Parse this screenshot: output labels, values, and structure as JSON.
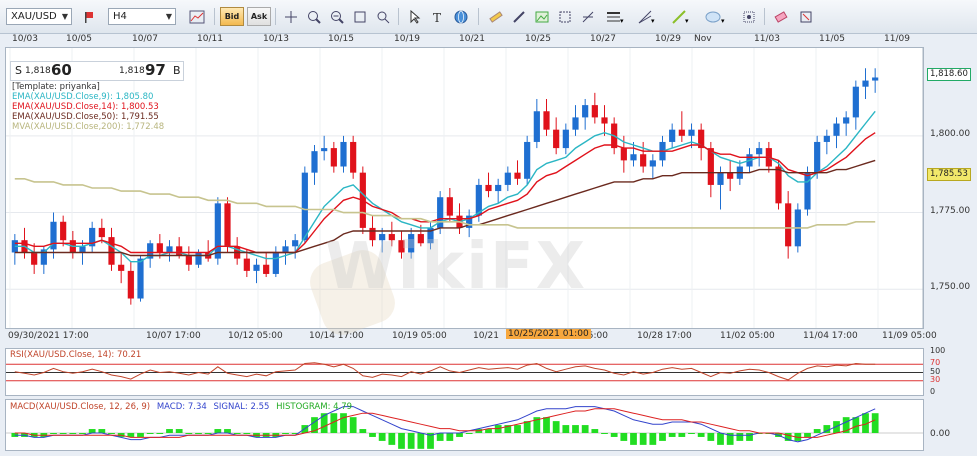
{
  "toolbar": {
    "symbol": "XAU/USD",
    "timeframe": "H4",
    "bid_label": "Bid",
    "ask_label": "Ask",
    "icons": [
      "flag-icon",
      "chart-icon",
      "bid-icon",
      "ask-icon",
      "crosshair-icon",
      "zoom-in-icon",
      "zoom-out-icon",
      "zoom-fit-icon",
      "cursor-icon",
      "text-icon",
      "shapes-icon",
      "globe-icon",
      "ruler-icon",
      "pen-icon",
      "picture-icon",
      "resize-icon",
      "fork-icon",
      "line-icon",
      "fan-icon",
      "trend-line-icon",
      "ellipse-icon",
      "settings-icon",
      "eraser-icon",
      "delete-icon"
    ]
  },
  "quote": {
    "sell_prefix": "S",
    "sell_small": "1,818",
    "sell_big": "60",
    "buy_small": "1,818",
    "buy_big": "97",
    "buy_prefix": "B"
  },
  "legend": {
    "template": "[Template: priyanka]",
    "ema9": "EMA(XAU/USD.Close,9): 1,805.80",
    "ema14": "EMA(XAU/USD.Close,14): 1,800.53",
    "ema50": "EMA(XAU/USD.Close,50): 1,791.55",
    "mva200": "MVA(XAU/USD.Close,200): 1,772.48"
  },
  "colors": {
    "ema9": "#2bb6c4",
    "ema14": "#e0121b",
    "ema50": "#6b2a1f",
    "mva200": "#c7c48f",
    "bull": "#1f6fd1",
    "bear": "#e0121b",
    "rsi": "#c0442a",
    "macd": "#3344cc",
    "signal": "#dd2222",
    "histogram": "#22dd22",
    "highlight": "#f7a73d"
  },
  "top_dates": [
    "10/03",
    "10/05",
    "10/07",
    "10/11",
    "10/13",
    "10/15",
    "10/19",
    "10/21",
    "10/25",
    "10/27",
    "10/29",
    "Nov",
    "11/03",
    "11/05",
    "11/09"
  ],
  "bottom_dates": [
    "09/30/2021 17:00",
    "10/07 17:00",
    "10/12 05:00",
    "10/14 17:00",
    "10/19 05:00",
    "10/21",
    "05:00",
    "10/28 17:00",
    "11/02 05:00",
    "11/04 17:00",
    "11/09 05:00"
  ],
  "crosshair_date": "10/25/2021 01:00",
  "price_ticks": [
    "1,800.00",
    "1,775.00",
    "1,750.00"
  ],
  "last_price": "1,818.60",
  "ema_tag": "1,785.53",
  "rsi": {
    "label": "RSI(XAU/USD.Close, 14): 70.21",
    "ticks": [
      "100",
      "70",
      "50",
      "30",
      "0"
    ]
  },
  "macd": {
    "label_main": "MACD(XAU/USD.Close, 12, 26, 9)",
    "label_macd": "MACD: 7.34",
    "label_signal": "SIGNAL: 2.55",
    "label_hist": "HISTOGRAM: 4.79",
    "tick": "0.00"
  },
  "watermark": "WikiFX",
  "chart_data": {
    "type": "candlestick",
    "ylim": [
      1740,
      1826
    ],
    "candles": [
      [
        1762,
        1768,
        1758,
        1766
      ],
      [
        1766,
        1770,
        1760,
        1762
      ],
      [
        1762,
        1765,
        1755,
        1758
      ],
      [
        1758,
        1764,
        1755,
        1763
      ],
      [
        1763,
        1775,
        1760,
        1772
      ],
      [
        1772,
        1774,
        1764,
        1766
      ],
      [
        1766,
        1769,
        1760,
        1762
      ],
      [
        1762,
        1766,
        1758,
        1764
      ],
      [
        1764,
        1772,
        1762,
        1770
      ],
      [
        1770,
        1773,
        1765,
        1767
      ],
      [
        1767,
        1770,
        1756,
        1758
      ],
      [
        1758,
        1762,
        1752,
        1756
      ],
      [
        1756,
        1759,
        1745,
        1747
      ],
      [
        1747,
        1761,
        1746,
        1760
      ],
      [
        1760,
        1766,
        1757,
        1765
      ],
      [
        1765,
        1768,
        1760,
        1762
      ],
      [
        1762,
        1766,
        1759,
        1764
      ],
      [
        1764,
        1767,
        1760,
        1761
      ],
      [
        1761,
        1764,
        1756,
        1758
      ],
      [
        1758,
        1763,
        1757,
        1762
      ],
      [
        1762,
        1766,
        1759,
        1760
      ],
      [
        1760,
        1780,
        1758,
        1778
      ],
      [
        1778,
        1780,
        1762,
        1764
      ],
      [
        1764,
        1767,
        1758,
        1760
      ],
      [
        1760,
        1763,
        1754,
        1756
      ],
      [
        1756,
        1760,
        1752,
        1758
      ],
      [
        1758,
        1762,
        1754,
        1755
      ],
      [
        1755,
        1764,
        1754,
        1762
      ],
      [
        1762,
        1766,
        1758,
        1764
      ],
      [
        1764,
        1768,
        1760,
        1766
      ],
      [
        1766,
        1790,
        1765,
        1788
      ],
      [
        1788,
        1797,
        1784,
        1795
      ],
      [
        1795,
        1800,
        1792,
        1796
      ],
      [
        1796,
        1798,
        1788,
        1790
      ],
      [
        1790,
        1800,
        1788,
        1798
      ],
      [
        1798,
        1800,
        1786,
        1788
      ],
      [
        1788,
        1790,
        1768,
        1770
      ],
      [
        1770,
        1774,
        1764,
        1766
      ],
      [
        1766,
        1770,
        1762,
        1768
      ],
      [
        1768,
        1772,
        1764,
        1766
      ],
      [
        1766,
        1769,
        1760,
        1762
      ],
      [
        1762,
        1770,
        1760,
        1768
      ],
      [
        1768,
        1771,
        1764,
        1765
      ],
      [
        1765,
        1772,
        1763,
        1770
      ],
      [
        1770,
        1782,
        1768,
        1780
      ],
      [
        1780,
        1783,
        1772,
        1774
      ],
      [
        1774,
        1778,
        1768,
        1770
      ],
      [
        1770,
        1776,
        1767,
        1774
      ],
      [
        1774,
        1786,
        1772,
        1784
      ],
      [
        1784,
        1788,
        1780,
        1782
      ],
      [
        1782,
        1786,
        1778,
        1784
      ],
      [
        1784,
        1790,
        1782,
        1788
      ],
      [
        1788,
        1792,
        1784,
        1786
      ],
      [
        1786,
        1800,
        1784,
        1798
      ],
      [
        1798,
        1812,
        1796,
        1808
      ],
      [
        1808,
        1812,
        1800,
        1802
      ],
      [
        1802,
        1806,
        1794,
        1796
      ],
      [
        1796,
        1804,
        1794,
        1802
      ],
      [
        1802,
        1810,
        1800,
        1806
      ],
      [
        1806,
        1812,
        1802,
        1810
      ],
      [
        1810,
        1814,
        1804,
        1806
      ],
      [
        1806,
        1810,
        1800,
        1804
      ],
      [
        1804,
        1806,
        1794,
        1796
      ],
      [
        1796,
        1800,
        1788,
        1792
      ],
      [
        1792,
        1798,
        1790,
        1794
      ],
      [
        1794,
        1798,
        1788,
        1790
      ],
      [
        1790,
        1794,
        1786,
        1792
      ],
      [
        1792,
        1800,
        1790,
        1798
      ],
      [
        1798,
        1804,
        1796,
        1802
      ],
      [
        1802,
        1808,
        1798,
        1800
      ],
      [
        1800,
        1804,
        1796,
        1802
      ],
      [
        1802,
        1804,
        1792,
        1796
      ],
      [
        1796,
        1798,
        1780,
        1784
      ],
      [
        1784,
        1790,
        1776,
        1788
      ],
      [
        1788,
        1792,
        1782,
        1786
      ],
      [
        1786,
        1792,
        1784,
        1790
      ],
      [
        1790,
        1796,
        1788,
        1794
      ],
      [
        1794,
        1798,
        1790,
        1796
      ],
      [
        1796,
        1798,
        1788,
        1790
      ],
      [
        1790,
        1792,
        1776,
        1778
      ],
      [
        1778,
        1782,
        1760,
        1764
      ],
      [
        1764,
        1778,
        1762,
        1776
      ],
      [
        1776,
        1790,
        1774,
        1788
      ],
      [
        1788,
        1800,
        1786,
        1798
      ],
      [
        1798,
        1802,
        1794,
        1800
      ],
      [
        1800,
        1806,
        1796,
        1804
      ],
      [
        1804,
        1808,
        1800,
        1806
      ],
      [
        1806,
        1818,
        1802,
        1816
      ],
      [
        1816,
        1822,
        1812,
        1818
      ],
      [
        1818,
        1822,
        1814,
        1819
      ]
    ],
    "series": [
      {
        "name": "EMA(XAU/USD.Close,9)",
        "values": [
          1764,
          1764,
          1762,
          1762,
          1765,
          1765,
          1764,
          1764,
          1765,
          1766,
          1764,
          1762,
          1759,
          1759,
          1761,
          1761,
          1762,
          1762,
          1761,
          1761,
          1761,
          1764,
          1764,
          1763,
          1762,
          1761,
          1760,
          1760,
          1761,
          1762,
          1767,
          1772,
          1777,
          1780,
          1783,
          1784,
          1781,
          1778,
          1776,
          1774,
          1772,
          1771,
          1770,
          1770,
          1772,
          1773,
          1772,
          1773,
          1775,
          1777,
          1778,
          1780,
          1781,
          1784,
          1789,
          1791,
          1792,
          1793,
          1796,
          1798,
          1800,
          1801,
          1800,
          1798,
          1797,
          1796,
          1795,
          1795,
          1796,
          1797,
          1798,
          1797,
          1795,
          1793,
          1792,
          1791,
          1792,
          1793,
          1793,
          1791,
          1787,
          1785,
          1785,
          1788,
          1790,
          1793,
          1796,
          1800,
          1804,
          1808
        ]
      },
      {
        "name": "EMA(XAU/USD.Close,14)",
        "values": [
          1765,
          1765,
          1764,
          1764,
          1765,
          1765,
          1765,
          1765,
          1765,
          1766,
          1765,
          1764,
          1762,
          1762,
          1762,
          1762,
          1762,
          1762,
          1762,
          1762,
          1762,
          1764,
          1764,
          1764,
          1763,
          1762,
          1762,
          1762,
          1762,
          1762,
          1765,
          1769,
          1773,
          1776,
          1779,
          1780,
          1779,
          1777,
          1776,
          1775,
          1773,
          1773,
          1772,
          1772,
          1773,
          1773,
          1773,
          1773,
          1774,
          1776,
          1777,
          1778,
          1779,
          1781,
          1785,
          1787,
          1788,
          1790,
          1792,
          1794,
          1796,
          1797,
          1797,
          1796,
          1796,
          1795,
          1795,
          1795,
          1795,
          1796,
          1797,
          1797,
          1795,
          1794,
          1794,
          1793,
          1793,
          1793,
          1793,
          1792,
          1789,
          1788,
          1787,
          1788,
          1789,
          1791,
          1793,
          1796,
          1799,
          1801
        ]
      },
      {
        "name": "EMA(XAU/USD.Close,50)",
        "values": [
          1762,
          1762,
          1762,
          1762,
          1762,
          1762,
          1762,
          1762,
          1762,
          1762,
          1762,
          1762,
          1761,
          1761,
          1761,
          1761,
          1761,
          1761,
          1761,
          1761,
          1761,
          1762,
          1762,
          1762,
          1762,
          1762,
          1762,
          1762,
          1762,
          1762,
          1763,
          1764,
          1765,
          1766,
          1768,
          1769,
          1769,
          1769,
          1769,
          1769,
          1769,
          1769,
          1769,
          1769,
          1770,
          1770,
          1770,
          1771,
          1771,
          1772,
          1773,
          1774,
          1775,
          1776,
          1777,
          1778,
          1779,
          1780,
          1781,
          1782,
          1783,
          1784,
          1785,
          1785,
          1785,
          1786,
          1786,
          1787,
          1787,
          1788,
          1788,
          1788,
          1788,
          1788,
          1788,
          1788,
          1788,
          1789,
          1789,
          1789,
          1788,
          1788,
          1788,
          1788,
          1788,
          1789,
          1789,
          1790,
          1791,
          1792
        ]
      },
      {
        "name": "MVA(XAU/USD.Close,200)",
        "values": [
          1786,
          1786,
          1785,
          1785,
          1785,
          1784,
          1784,
          1784,
          1783,
          1783,
          1783,
          1782,
          1782,
          1782,
          1781,
          1781,
          1781,
          1780,
          1780,
          1780,
          1779,
          1779,
          1779,
          1778,
          1778,
          1778,
          1777,
          1777,
          1777,
          1777,
          1776,
          1776,
          1776,
          1776,
          1775,
          1775,
          1775,
          1774,
          1774,
          1774,
          1773,
          1773,
          1773,
          1772,
          1772,
          1772,
          1772,
          1771,
          1771,
          1771,
          1771,
          1771,
          1770,
          1770,
          1770,
          1770,
          1770,
          1770,
          1770,
          1770,
          1770,
          1770,
          1770,
          1770,
          1770,
          1770,
          1770,
          1770,
          1770,
          1770,
          1770,
          1770,
          1770,
          1770,
          1770,
          1770,
          1770,
          1770,
          1770,
          1770,
          1770,
          1770,
          1770,
          1771,
          1771,
          1771,
          1771,
          1772,
          1772,
          1772
        ]
      }
    ],
    "rsi_values": [
      52,
      48,
      44,
      50,
      60,
      52,
      48,
      52,
      58,
      52,
      44,
      40,
      34,
      46,
      56,
      50,
      52,
      48,
      44,
      50,
      46,
      64,
      48,
      44,
      40,
      46,
      42,
      52,
      54,
      56,
      72,
      74,
      70,
      64,
      70,
      60,
      42,
      38,
      46,
      44,
      40,
      52,
      46,
      54,
      64,
      54,
      50,
      56,
      62,
      58,
      60,
      62,
      58,
      68,
      72,
      60,
      52,
      58,
      64,
      66,
      60,
      56,
      48,
      44,
      52,
      46,
      50,
      58,
      62,
      58,
      60,
      50,
      40,
      50,
      48,
      54,
      58,
      56,
      50,
      40,
      32,
      48,
      60,
      66,
      64,
      68,
      66,
      72,
      70,
      70
    ],
    "macd_values": [
      -1,
      -1,
      -2,
      -2,
      -1,
      -1,
      -1,
      -1,
      0,
      0,
      -1,
      -2,
      -3,
      -3,
      -2,
      -2,
      -1,
      -1,
      -1,
      -1,
      -1,
      0,
      0,
      -1,
      -1,
      -2,
      -2,
      -2,
      -1,
      -1,
      2,
      5,
      8,
      10,
      12,
      12,
      10,
      8,
      6,
      4,
      2,
      1,
      0,
      -1,
      0,
      0,
      0,
      1,
      2,
      3,
      4,
      5,
      6,
      8,
      10,
      11,
      11,
      11,
      12,
      12,
      12,
      11,
      10,
      8,
      6,
      5,
      4,
      4,
      5,
      5,
      5,
      4,
      2,
      0,
      -1,
      -1,
      -1,
      0,
      0,
      -1,
      -3,
      -4,
      -3,
      -1,
      1,
      3,
      5,
      7,
      9,
      11
    ],
    "signal_values": [
      0,
      0,
      -1,
      -1,
      -1,
      -1,
      -1,
      -1,
      -1,
      -1,
      -1,
      -1,
      -2,
      -2,
      -2,
      -2,
      -2,
      -2,
      -1,
      -1,
      -1,
      -1,
      -1,
      -1,
      -1,
      -1,
      -1,
      -1,
      -1,
      -1,
      0,
      1,
      3,
      5,
      7,
      8,
      9,
      9,
      8,
      7,
      6,
      5,
      4,
      3,
      2,
      2,
      1,
      1,
      1,
      2,
      2,
      3,
      4,
      5,
      6,
      7,
      8,
      9,
      10,
      10,
      11,
      11,
      11,
      10,
      9,
      8,
      7,
      6,
      6,
      6,
      5,
      5,
      4,
      3,
      2,
      1,
      1,
      0,
      0,
      0,
      -1,
      -2,
      -2,
      -2,
      -1,
      0,
      1,
      3,
      4,
      6
    ]
  }
}
